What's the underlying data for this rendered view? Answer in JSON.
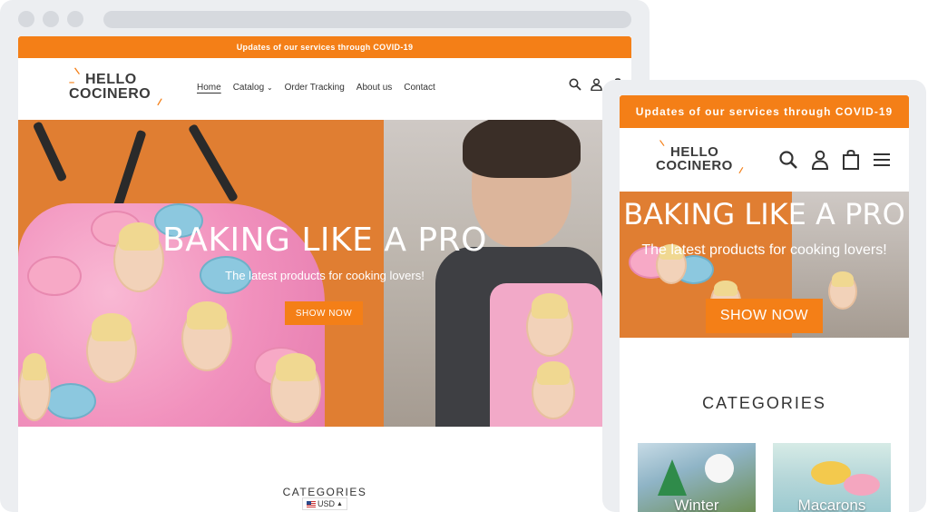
{
  "desktop": {
    "announcement": "Updates of our services through COVID-19",
    "logo": {
      "line1": "HELLO",
      "line2": "COCINERO"
    },
    "nav": [
      {
        "label": "Home",
        "active": true
      },
      {
        "label": "Catalog",
        "has_dropdown": true
      },
      {
        "label": "Order Tracking"
      },
      {
        "label": "About us"
      },
      {
        "label": "Contact"
      }
    ],
    "header_icons": [
      "search-icon",
      "account-icon",
      "cart-icon"
    ],
    "hero": {
      "title": "BAKING LIKE A PRO",
      "subtitle": "The latest products for cooking lovers!",
      "button": "SHOW NOW"
    },
    "categories_heading": "CATEGORIES",
    "currency": "USD"
  },
  "mobile": {
    "announcement": "Updates of our services through COVID-19",
    "logo": {
      "line1": "HELLO",
      "line2": "COCINERO"
    },
    "header_icons": [
      "search-icon",
      "account-icon",
      "cart-icon",
      "menu-icon"
    ],
    "hero": {
      "title": "BAKING LIKE A PRO",
      "subtitle": "The latest products for cooking lovers!",
      "button": "SHOW NOW"
    },
    "categories_heading": "CATEGORIES",
    "categories": [
      {
        "label": "Winter"
      },
      {
        "label": "Macarons"
      }
    ]
  },
  "colors": {
    "accent": "#f47f17",
    "hero_orange": "#e07e32",
    "frame": "#eceef1",
    "text": "#333333"
  }
}
